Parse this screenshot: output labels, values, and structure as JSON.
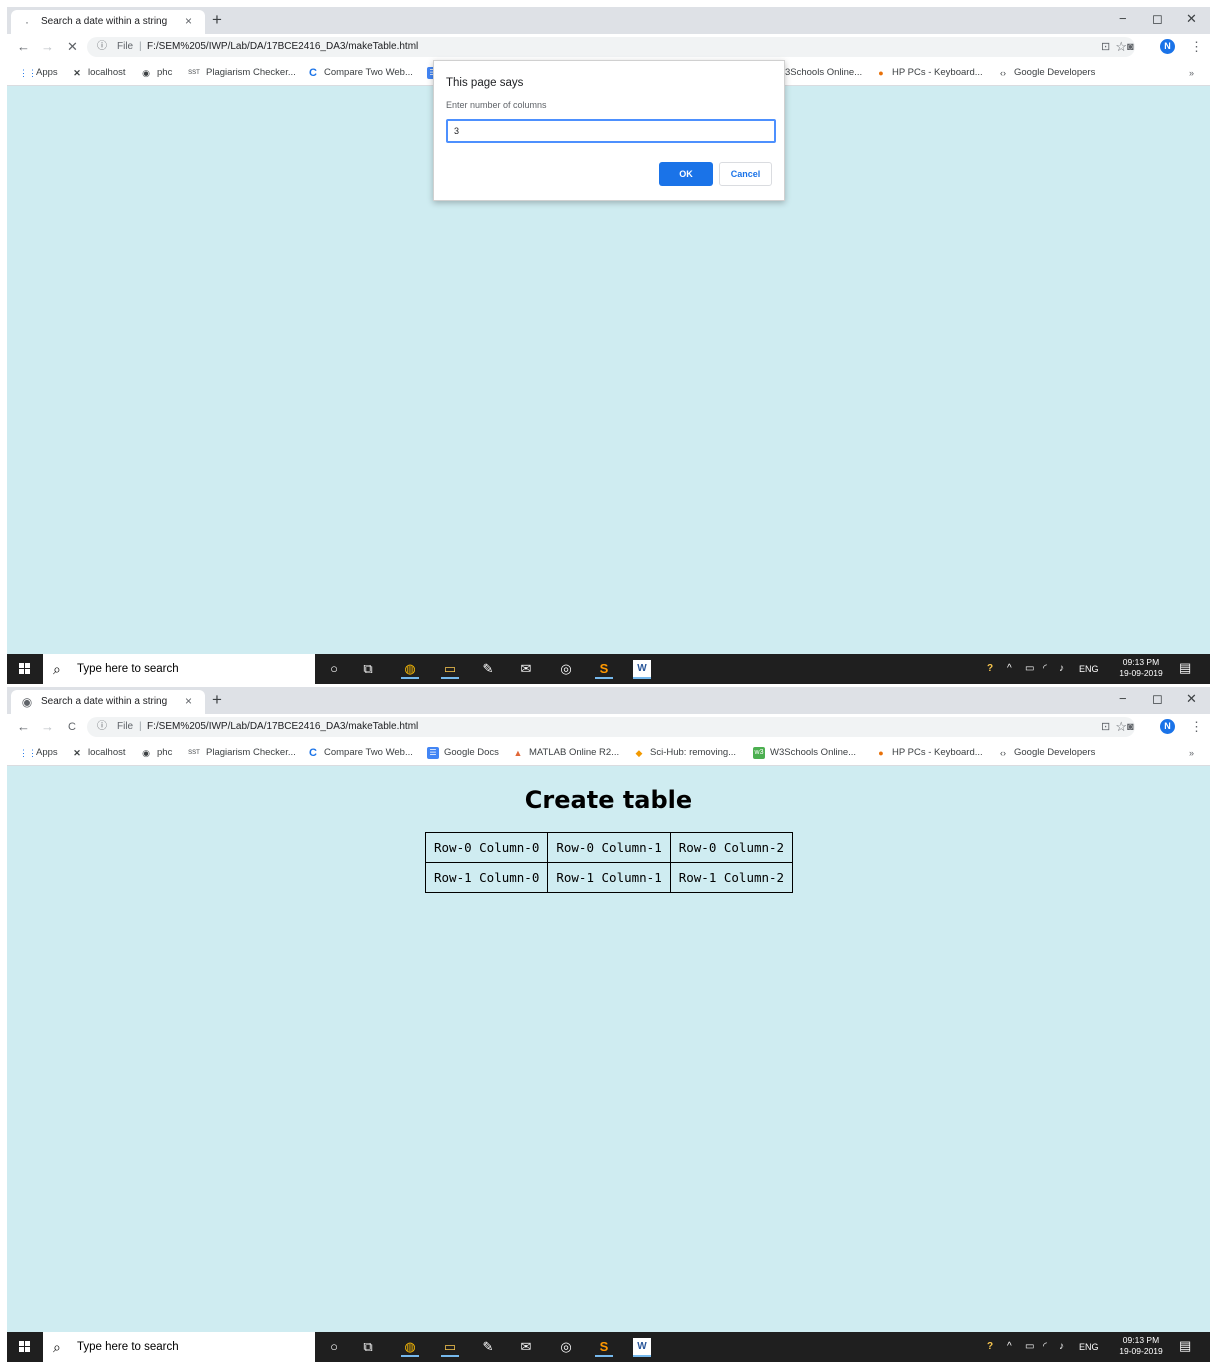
{
  "tab": {
    "title": "Search a date within a string",
    "close": "×",
    "new_tab": "+"
  },
  "window": {
    "minimize": "−",
    "maximize": "◻",
    "close": "✕"
  },
  "toolbar": {
    "back": "←",
    "forward": "→",
    "stop": "✕",
    "reload": "C",
    "star": "☆",
    "menu": "⋮",
    "avatar": "N"
  },
  "address": {
    "info": "ⓘ",
    "file_label": "File",
    "separator": "|",
    "url": "F:/SEM%205/IWP/Lab/DA/17BCE2416_DA3/makeTable.html"
  },
  "bookmarks": {
    "items": [
      {
        "label": "Apps",
        "icon": "⋮⋮",
        "color": "#1a73e8"
      },
      {
        "label": "localhost",
        "icon": "✕",
        "color": "#202124"
      },
      {
        "label": "phc",
        "icon": "◉",
        "color": "#5f6368"
      },
      {
        "label": "Plagiarism Checker...",
        "icon": "SST",
        "color": "#5f6368"
      },
      {
        "label": "Compare Two Web...",
        "icon": "C",
        "color": "#1a73e8"
      },
      {
        "label": "Google Docs",
        "icon": "☰",
        "color": "#4285f4"
      },
      {
        "label": "MATLAB Online R2...",
        "icon": "▲",
        "color": "#e16737"
      },
      {
        "label": "Sci-Hub: removing...",
        "icon": "◆",
        "color": "#f29900"
      },
      {
        "label": "W3Schools Online...",
        "icon": "w3",
        "color": "#4caf50"
      },
      {
        "label": "HP PCs - Keyboard...",
        "icon": "●",
        "color": "#e8710a"
      },
      {
        "label": "Google Developers",
        "icon": "‹›",
        "color": "#5f6368"
      }
    ],
    "dialog_overlap_label": "3Schools Online...",
    "more": "»"
  },
  "dialog": {
    "title": "This page says",
    "message": "Enter number of columns",
    "input_value": "3",
    "ok_label": "OK",
    "cancel_label": "Cancel"
  },
  "page": {
    "heading": "Create table",
    "table_rows": [
      [
        "Row-0 Column-0",
        "Row-0 Column-1",
        "Row-0 Column-2"
      ],
      [
        "Row-1 Column-0",
        "Row-1 Column-1",
        "Row-1 Column-2"
      ]
    ]
  },
  "taskbar": {
    "search_placeholder": "Type here to search",
    "search_icon": "⌕",
    "icons": [
      {
        "name": "cortana-icon",
        "glyph": "○"
      },
      {
        "name": "task-view-icon",
        "glyph": "⧉"
      },
      {
        "name": "chrome-icon",
        "glyph": "◍"
      },
      {
        "name": "file-explorer-icon",
        "glyph": "▭"
      },
      {
        "name": "paint-icon",
        "glyph": "✎"
      },
      {
        "name": "mail-icon",
        "glyph": "✉"
      },
      {
        "name": "media-icon",
        "glyph": "◎"
      },
      {
        "name": "sublime-text-icon",
        "glyph": "S"
      },
      {
        "name": "word-icon",
        "glyph": "W"
      }
    ],
    "tray": {
      "help": "?",
      "chevron": "^",
      "battery": "▭",
      "wifi": "◜",
      "volume": "♪",
      "lang": "ENG"
    },
    "time": "09:13 PM",
    "date": "19-09-2019",
    "notifications": "▤"
  }
}
